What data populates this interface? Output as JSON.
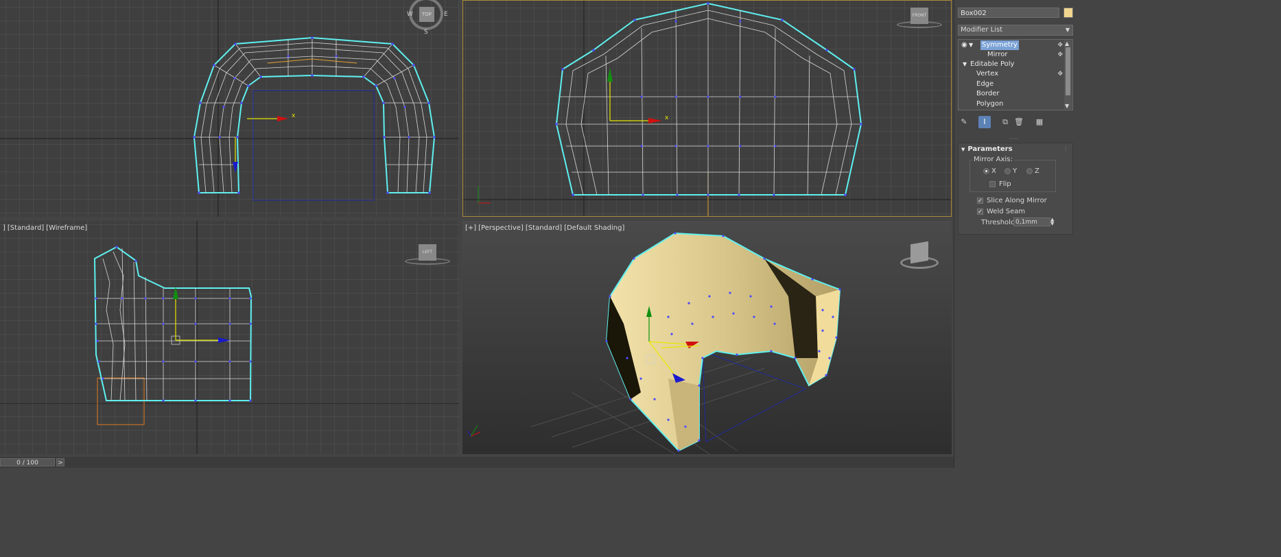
{
  "viewports": {
    "bottom_left_label": [
      "]",
      "[Standard]",
      "[Wireframe]"
    ],
    "bottom_right_label": [
      "[+]",
      "[Perspective]",
      "[Standard]",
      "[Default Shading]"
    ],
    "compass": {
      "w": "W",
      "e": "E",
      "s": "S",
      "top": "TOP"
    },
    "front_cube": "FRONT",
    "left_cube": "LEFT",
    "axis_x": "x"
  },
  "panel": {
    "object_name": "Box002",
    "object_color": "#f1d58f",
    "modifier_list": "Modifier List",
    "stack": [
      {
        "label": "Symmetry",
        "selected": true
      },
      {
        "label": "Mirror"
      },
      {
        "label": "Editable Poly"
      },
      {
        "label": "Vertex"
      },
      {
        "label": "Edge"
      },
      {
        "label": "Border"
      },
      {
        "label": "Polygon"
      }
    ],
    "rollout_title": "Parameters",
    "mirror_axis_label": "Mirror Axis:",
    "axes": [
      "X",
      "Y",
      "Z"
    ],
    "selected_axis": "X",
    "flip_label": "Flip",
    "slice_label": "Slice Along Mirror",
    "weld_label": "Weld Seam",
    "threshold_label": "Threshold:",
    "threshold_value": "0,1mm"
  },
  "timeline": {
    "value": "0 / 100",
    "next": ">"
  },
  "colors": {
    "selection_outline": "#5ff0f0",
    "vertex": "#4b4bff",
    "mesh_fill": "#e6d49a"
  }
}
